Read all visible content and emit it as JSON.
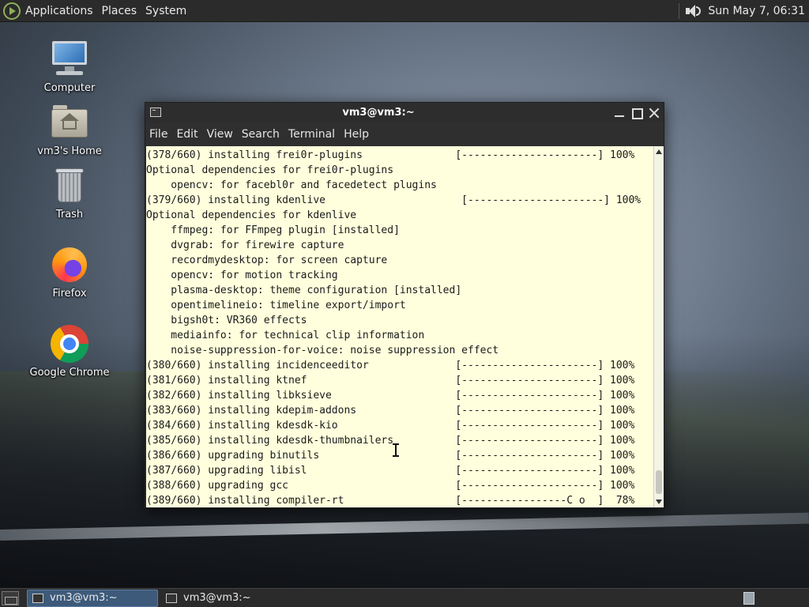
{
  "top_panel": {
    "menus": [
      "Applications",
      "Places",
      "System"
    ],
    "clock": "Sun May 7, 06:31"
  },
  "desktop_icons": {
    "computer": "Computer",
    "home": "vm3's Home",
    "trash": "Trash",
    "firefox": "Firefox",
    "chrome": "Google Chrome"
  },
  "window": {
    "title": "vm3@vm3:~",
    "menu": [
      "File",
      "Edit",
      "View",
      "Search",
      "Terminal",
      "Help"
    ],
    "lines": [
      "(378/660) installing frei0r-plugins               [----------------------] 100%",
      "Optional dependencies for frei0r-plugins",
      "    opencv: for facebl0r and facedetect plugins",
      "(379/660) installing kdenlive                      [----------------------] 100%",
      "Optional dependencies for kdenlive",
      "    ffmpeg: for FFmpeg plugin [installed]",
      "    dvgrab: for firewire capture",
      "    recordmydesktop: for screen capture",
      "    opencv: for motion tracking",
      "    plasma-desktop: theme configuration [installed]",
      "    opentimelineio: timeline export/import",
      "    bigsh0t: VR360 effects",
      "    mediainfo: for technical clip information",
      "    noise-suppression-for-voice: noise suppression effect",
      "(380/660) installing incidenceeditor              [----------------------] 100%",
      "(381/660) installing ktnef                        [----------------------] 100%",
      "(382/660) installing libksieve                    [----------------------] 100%",
      "(383/660) installing kdepim-addons                [----------------------] 100%",
      "(384/660) installing kdesdk-kio                   [----------------------] 100%",
      "(385/660) installing kdesdk-thumbnailers          [----------------------] 100%",
      "(386/660) upgrading binutils                      [----------------------] 100%",
      "(387/660) upgrading libisl                        [----------------------] 100%",
      "(388/660) upgrading gcc                           [----------------------] 100%",
      "(389/660) installing compiler-rt                  [-----------------C o  ]  78%"
    ]
  },
  "taskbar": {
    "tasks": [
      "vm3@vm3:~",
      "vm3@vm3:~"
    ]
  }
}
